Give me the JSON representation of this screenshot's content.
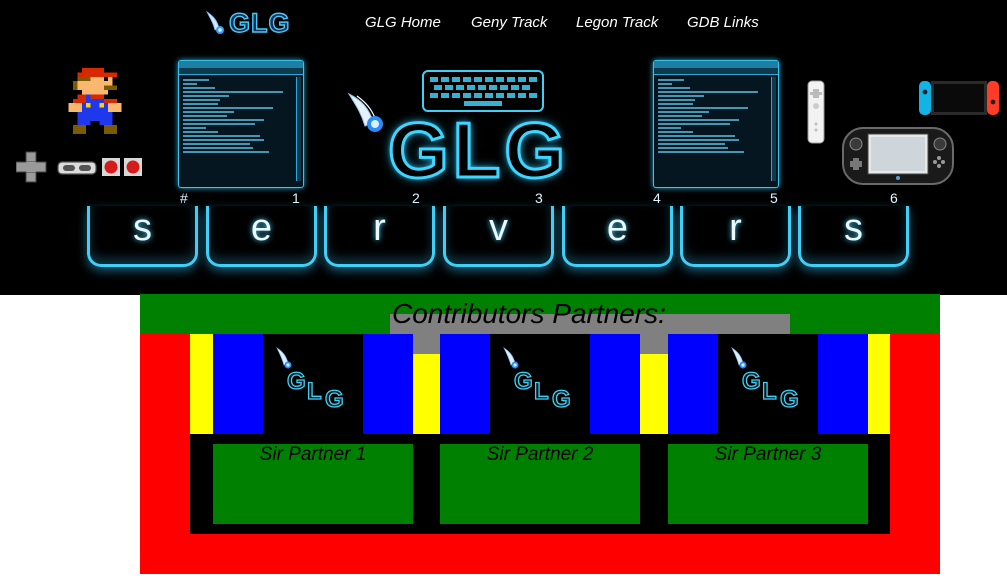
{
  "header": {
    "logo_text": "GLG",
    "nav": [
      "GLG Home",
      "Geny Track",
      "Legon Track",
      "GDB Links"
    ],
    "banner_logo_text": "GLG",
    "keys": [
      {
        "letter": "s",
        "num": "#"
      },
      {
        "letter": "e",
        "num": "1"
      },
      {
        "letter": "r",
        "num": "2"
      },
      {
        "letter": "v",
        "num": "3"
      },
      {
        "letter": "e",
        "num": "4"
      },
      {
        "letter": "r",
        "num": "5"
      },
      {
        "letter": "s",
        "num": "6"
      }
    ]
  },
  "partners": {
    "title": "Contributors Partners:",
    "logo_letters": [
      "G",
      "L",
      "G"
    ],
    "items": [
      {
        "name": "Sir Partner 1"
      },
      {
        "name": "Sir Partner 2"
      },
      {
        "name": "Sir Partner 3"
      }
    ]
  },
  "colors": {
    "banner_bg": "#000000",
    "neon": "#3ed6ff",
    "section_green": "#008000",
    "section_red": "#ff0000",
    "section_gray": "#808080",
    "accent_yellow": "#ffff00",
    "accent_blue": "#0000ff"
  },
  "icons": [
    "wing-icon",
    "mario-sprite",
    "nes-controller-icon",
    "terminal-window-icon",
    "keyboard-icon",
    "wiimote-icon",
    "switch-icon",
    "wiiu-gamepad-icon"
  ]
}
